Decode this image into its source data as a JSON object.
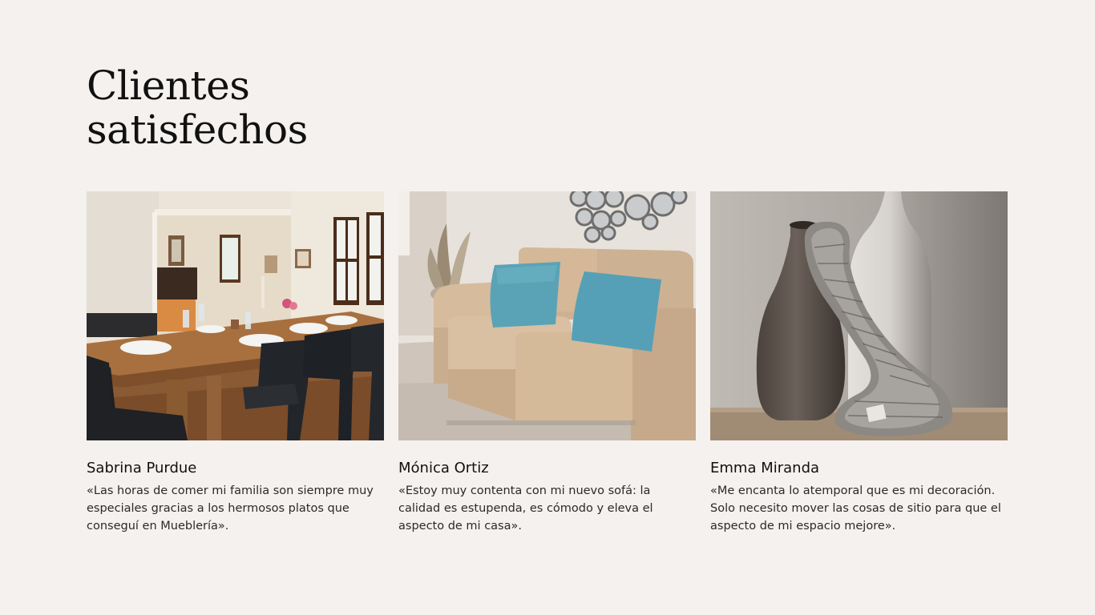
{
  "heading": {
    "line1": "Clientes",
    "line2": "satisfechos"
  },
  "testimonials": [
    {
      "name": "Sabrina Purdue",
      "quote": "«Las horas de comer mi familia son siempre muy especiales gracias a los hermosos platos que conseguí en Mueblería».",
      "image_subject": "dining-room-photo"
    },
    {
      "name": "Mónica Ortiz",
      "quote": "«Estoy muy contenta con mi nuevo sofá: la calidad es estupenda, es cómodo y eleva el aspecto de mi casa».",
      "image_subject": "sofa-photo"
    },
    {
      "name": "Emma Miranda",
      "quote": "«Me encanta lo atemporal que es mi decoración. Solo necesito mover las cosas de sitio para que el aspecto de mi espacio mejore».",
      "image_subject": "vases-photo"
    }
  ]
}
